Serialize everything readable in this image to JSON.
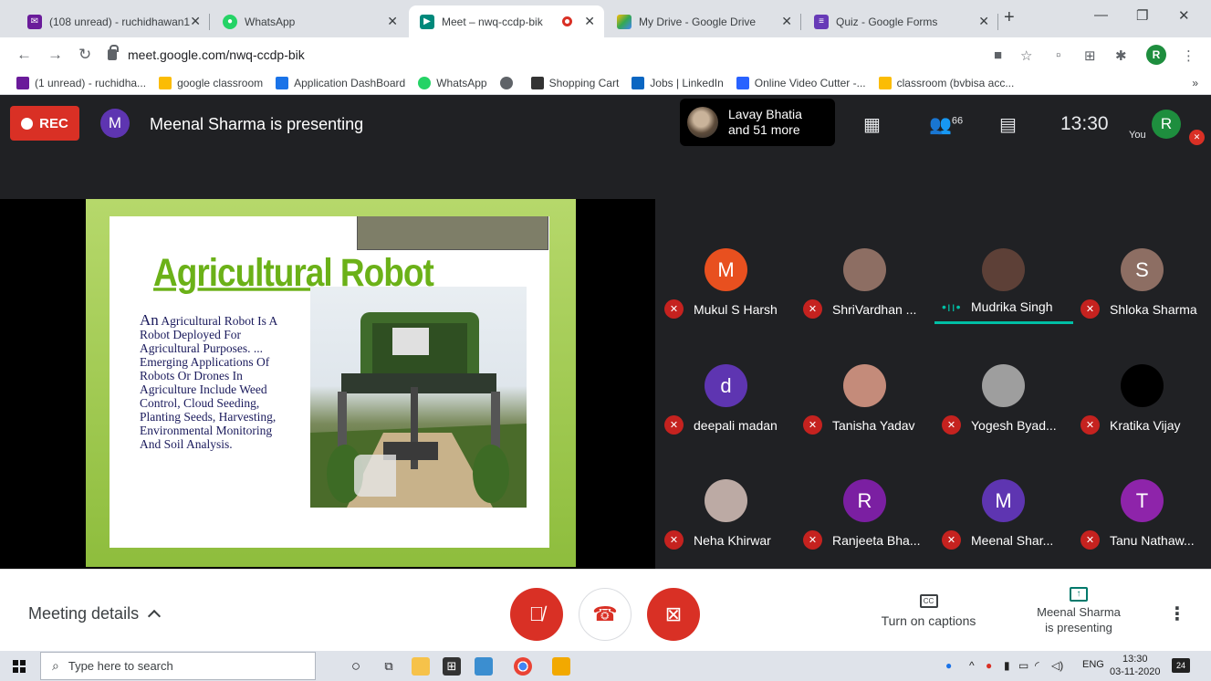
{
  "browser": {
    "tabs": [
      {
        "title": "(108 unread) - ruchidhawan1",
        "color": "#6a1b9a",
        "close": "✕"
      },
      {
        "title": "WhatsApp",
        "color": "#25d366",
        "close": "✕"
      },
      {
        "title": "Meet – nwq-ccdp-bik",
        "color": "#00897b",
        "close": "✕",
        "active": true
      },
      {
        "title": "My Drive - Google Drive",
        "color": "#fbbc04",
        "close": "✕"
      },
      {
        "title": "Quiz - Google Forms",
        "color": "#673ab7",
        "close": "✕"
      }
    ],
    "new_tab": "+",
    "url": "meet.google.com/nwq-ccdp-bik",
    "profile_initial": "R",
    "bookmarks": [
      {
        "label": "(1 unread) - ruchidha...",
        "color": "#6a1b9a"
      },
      {
        "label": "google classroom",
        "color": "#fbbc04"
      },
      {
        "label": "Application DashBoard",
        "color": "#1a73e8"
      },
      {
        "label": "WhatsApp",
        "color": "#25d366"
      },
      {
        "label": "",
        "color": "#5f6368"
      },
      {
        "label": "Shopping Cart",
        "color": "#333333"
      },
      {
        "label": "Jobs | LinkedIn",
        "color": "#0a66c2"
      },
      {
        "label": "Online Video Cutter -...",
        "color": "#2962ff"
      },
      {
        "label": "classroom (bvbisa acc...",
        "color": "#fbbc04"
      }
    ],
    "bookmarks_overflow": "»"
  },
  "meet": {
    "rec_label": "REC",
    "presenter_initial": "M",
    "presenting_text": "Meenal Sharma is presenting",
    "pinned_name_line1": "Lavay Bhatia",
    "pinned_name_line2": "and 51 more",
    "people_count": "66",
    "time": "13:30",
    "you_label": "You",
    "self_initial": "R",
    "slide": {
      "title": "Agricultural Robot",
      "body_first": "An",
      "body_rest": " Agricultural Robot Is A Robot Deployed For Agricultural Purposes. ... Emerging Applications Of Robots Or Drones In Agriculture Include Weed Control, Cloud Seeding, Planting Seeds, Harvesting, Environmental Monitoring And Soil Analysis."
    },
    "participants": [
      {
        "name": "Mukul S Harsh",
        "initial": "M",
        "color": "#e8501f"
      },
      {
        "name": "ShriVardhan ...",
        "initial": "",
        "color": "#8d6e63"
      },
      {
        "name": "Mudrika Singh",
        "initial": "",
        "color": "#5d4037",
        "speaking": true
      },
      {
        "name": "Shloka Sharma",
        "initial": "S",
        "color": "#8d6e63"
      },
      {
        "name": "deepali madan",
        "initial": "d",
        "color": "#5e35b1"
      },
      {
        "name": "Tanisha Yadav",
        "initial": "",
        "color": "#c48b7a"
      },
      {
        "name": "Yogesh Byad...",
        "initial": "",
        "color": "#9e9e9e"
      },
      {
        "name": "Kratika Vijay",
        "initial": "",
        "color": "#000000"
      },
      {
        "name": "Neha Khirwar",
        "initial": "",
        "color": "#bcaaa4"
      },
      {
        "name": "Ranjeeta Bha...",
        "initial": "R",
        "color": "#7b1fa2"
      },
      {
        "name": "Meenal Shar...",
        "initial": "M",
        "color": "#5e35b1"
      },
      {
        "name": "Tanu Nathaw...",
        "initial": "T",
        "color": "#8e24aa"
      }
    ],
    "bottom": {
      "meeting_details": "Meeting details",
      "captions_icon": "CC",
      "captions_label": "Turn on captions",
      "presenting_line1": "Meenal Sharma",
      "presenting_line2": "is presenting"
    }
  },
  "taskbar": {
    "search_placeholder": "Type here to search",
    "lang": "ENG",
    "time": "13:30",
    "date": "03-11-2020",
    "notifications": "24"
  }
}
